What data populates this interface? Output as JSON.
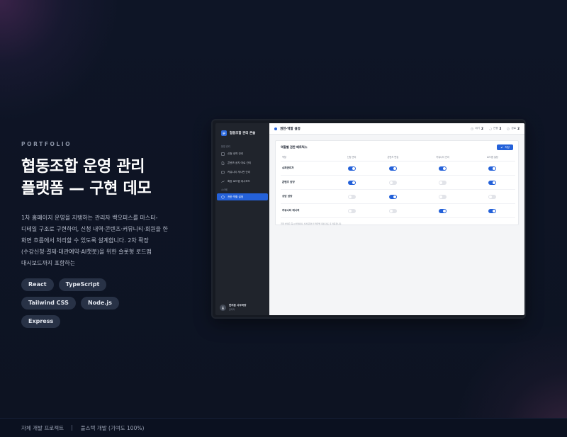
{
  "intro": {
    "eyebrow": "PORTFOLIO",
    "title_lines": [
      "협동조합 운영 관리",
      "플랫폼 — 구현 데모"
    ],
    "description_lines": [
      "1차 홈페이지 운영을 지탱하는 관리자 백오피스를 마스터-",
      "디테일 구조로 구현하여, 신청 내역·콘텐츠·커뮤니티·회원을 한",
      "화면 흐름에서 처리할 수 있도록 설계합니다. 2차 확장",
      "(수강신청·결제·대관예약·AI챗봇)을 위한 슬롯형 로드맵",
      "대시보드까지 포함하는"
    ],
    "tags": [
      "React",
      "TypeScript",
      "Tailwind CSS",
      "Node.js",
      "Express"
    ]
  },
  "footer": {
    "left": "자체 개발 프로젝트",
    "right": "풀스택 개발 (기여도 100%)"
  },
  "app": {
    "brand": "협동조합 관리 콘솔",
    "sidebar": {
      "group1": "운영 관리",
      "items": [
        {
          "label": "신청 내역 관리",
          "icon": "list-icon"
        },
        {
          "label": "콘텐츠·공지·자료 관리",
          "icon": "document-icon"
        },
        {
          "label": "커뮤니티 게시판 관리",
          "icon": "chat-icon"
        },
        {
          "label": "확장 로드맵 대시보드",
          "icon": "roadmap-icon"
        }
      ],
      "group2": "시스템",
      "active_item": {
        "label": "권한·역할 설정",
        "icon": "shield-icon"
      },
      "user": {
        "name": "한지훈 사무국장",
        "role": "관리자"
      }
    },
    "topbar": {
      "title": "권한·역할 설정",
      "stats": [
        {
          "label": "대기",
          "value": "2",
          "icon": "clock-icon"
        },
        {
          "label": "진행",
          "value": "2",
          "icon": "spinner-icon"
        },
        {
          "label": "완료",
          "value": "2",
          "icon": "check-icon"
        }
      ]
    },
    "card": {
      "title": "역할별 권한 매트릭스",
      "save_label": "저장",
      "columns": [
        "역할",
        "신청 관리",
        "콘텐츠 편집",
        "커뮤니티 관리",
        "로드맵 설정"
      ],
      "rows": [
        {
          "role": "슈퍼관리자",
          "perms": [
            true,
            true,
            true,
            true
          ]
        },
        {
          "role": "콘텐츠 담당",
          "perms": [
            true,
            false,
            false,
            true
          ]
        },
        {
          "role": "상담 담당",
          "perms": [
            false,
            true,
            false,
            false
          ]
        },
        {
          "role": "커뮤니티 매니저",
          "perms": [
            false,
            false,
            true,
            true
          ]
        }
      ],
      "note": "권한 변경은 즉시 반영되며, 실제 운영 전 역할별 계정 검토 후 적용합니다."
    }
  }
}
